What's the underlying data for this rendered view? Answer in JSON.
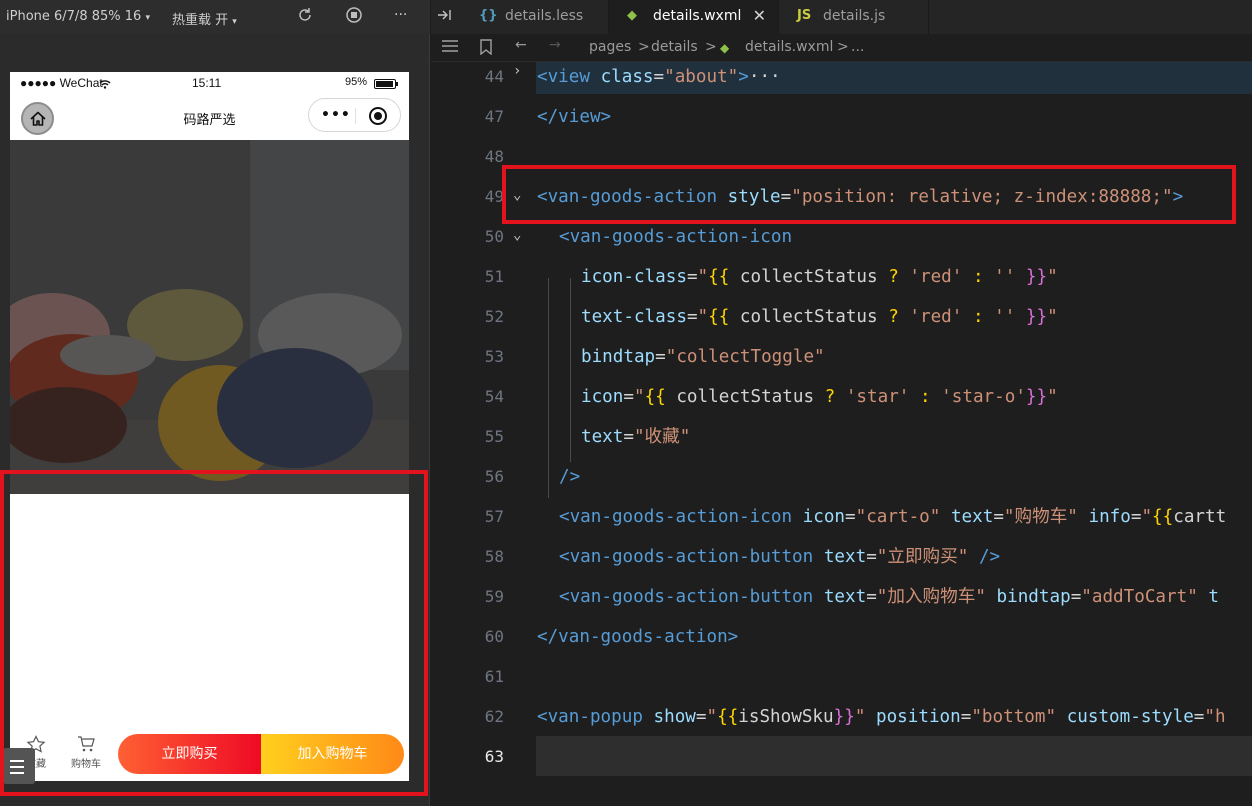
{
  "simulator": {
    "device": "iPhone 6/7/8 85% 16",
    "device_arrow": "▾",
    "hot_reload": "热重载 开",
    "hot_reload_arrow": "▾",
    "more": "···",
    "status": {
      "carrier": "●●●●● WeChat",
      "time": "15:11",
      "battery_text": "95%",
      "battery_level": 0.95
    },
    "nav_title": "码路严选",
    "capsule_dots": "•••",
    "goods_action": {
      "collect_label": "收藏",
      "cart_label": "购物车",
      "buy_now_label": "立即购买",
      "add_cart_label": "加入购物车",
      "buy_gradient": [
        "#ff6034",
        "#ee0a24"
      ],
      "cart_gradient": [
        "#ffd01e",
        "#ff8917"
      ]
    }
  },
  "editor": {
    "tabs": [
      {
        "label": "details.less",
        "icon": "{}",
        "icon_color": "#519aba",
        "active": false
      },
      {
        "label": "details.wxml",
        "icon": "◆",
        "icon_color": "#8dc149",
        "active": true
      },
      {
        "label": "details.js",
        "icon": "JS",
        "icon_color": "#cbcb41",
        "active": false
      }
    ],
    "close_glyph": "✕",
    "breadcrumb": {
      "nav_back": "←",
      "nav_fwd": "→",
      "seg1": "pages",
      "sep": ">",
      "seg2": "details",
      "seg3": "details.wxml",
      "ellipsis": "..."
    },
    "lines": [
      {
        "n": "44",
        "text": "<view class=\"about\">···"
      },
      {
        "n": "47",
        "text": "</view>"
      },
      {
        "n": "48",
        "text": ""
      },
      {
        "n": "49",
        "text": "<van-goods-action style=\"position: relative; z-index:88888;\">"
      },
      {
        "n": "50",
        "text": "<van-goods-action-icon"
      },
      {
        "n": "51",
        "text": "icon-class=\"{{ collectStatus ? 'red' : '' }}\""
      },
      {
        "n": "52",
        "text": "text-class=\"{{ collectStatus ? 'red' : '' }}\""
      },
      {
        "n": "53",
        "text": "bindtap=\"collectToggle\""
      },
      {
        "n": "54",
        "text": "icon=\"{{ collectStatus ? 'star' : 'star-o'}}\""
      },
      {
        "n": "55",
        "text": "text=\"收藏\""
      },
      {
        "n": "56",
        "text": "/>"
      },
      {
        "n": "57",
        "text": "<van-goods-action-icon icon=\"cart-o\" text=\"购物车\" info=\"{{cartt"
      },
      {
        "n": "58",
        "text": "<van-goods-action-button text=\"立即购买\" />"
      },
      {
        "n": "59",
        "text": "<van-goods-action-button text=\"加入购物车\" bindtap=\"addToCart\" t"
      },
      {
        "n": "60",
        "text": "</van-goods-action>"
      },
      {
        "n": "61",
        "text": ""
      },
      {
        "n": "62",
        "text": "<van-popup show=\"{{isShowSku}}\" position=\"bottom\" custom-style=\"h"
      },
      {
        "n": "63",
        "text": ""
      }
    ]
  }
}
